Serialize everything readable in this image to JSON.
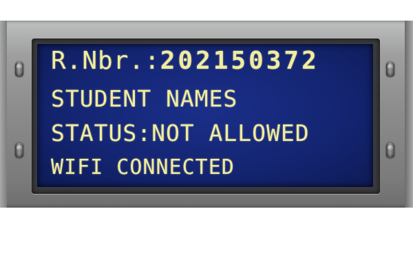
{
  "display": {
    "reg_label": "R.Nbr.:",
    "reg_number": "202150372",
    "student_line": "STUDENT NAMES",
    "status_line": "STATUS:NOT ALLOWED",
    "wifi_line": "WIFI CONNECTED"
  },
  "colors": {
    "lcd_background": "#142573",
    "lcd_text": "#f1ec9f",
    "bezel": "#8a8b8a"
  },
  "icons": [
    "screw-icon"
  ]
}
